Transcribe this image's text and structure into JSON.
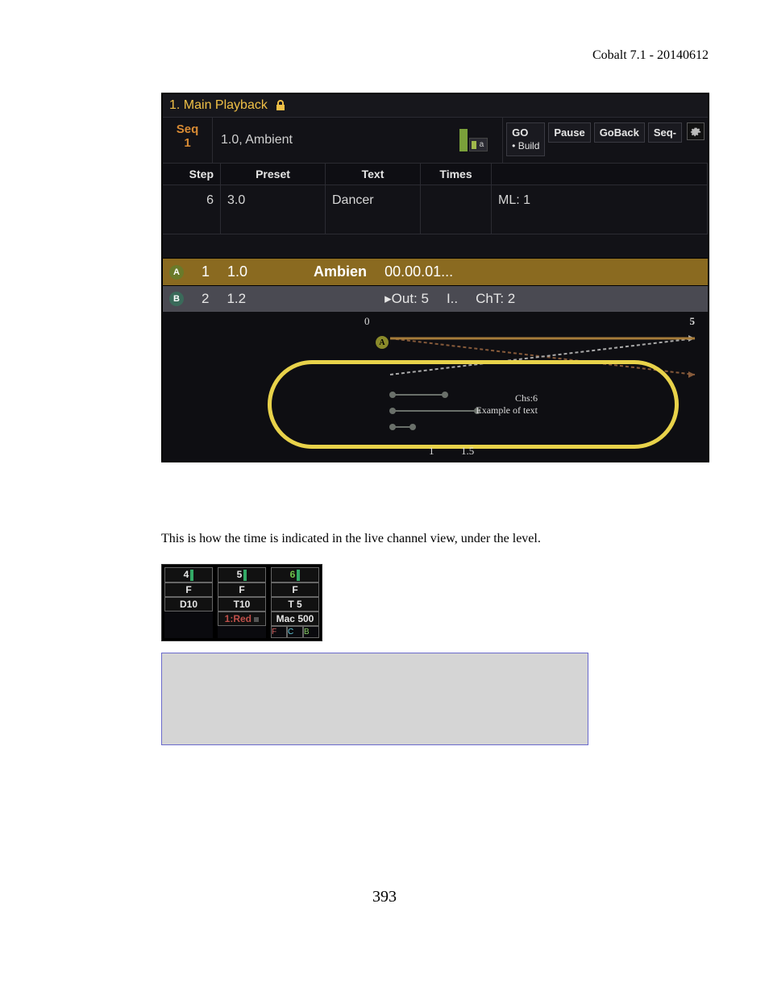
{
  "header": {
    "text": "Cobalt 7.1 - 20140612"
  },
  "panel": {
    "title": "1. Main Playback",
    "seq": {
      "label": "Seq",
      "num": "1",
      "info": "1.0, Ambient",
      "chip_label": "a"
    },
    "controls": {
      "go": "GO",
      "go_sub": "• Build",
      "pause": "Pause",
      "goback": "GoBack",
      "seqminus": "Seq-"
    },
    "columns": {
      "step": "Step",
      "preset": "Preset",
      "text": "Text",
      "times": "Times"
    },
    "row_dancer": {
      "step": "6",
      "preset": "3.0",
      "text": "Dancer",
      "ml": "ML: 1"
    },
    "row_a": {
      "badge": "A",
      "num": "1",
      "preset": "1.0",
      "text": "Ambien",
      "time": "00.00.01..."
    },
    "row_b": {
      "badge": "B",
      "num": "2",
      "preset": "1.2",
      "out": "▸Out: 5",
      "in": "I..",
      "cht": "ChT: 2"
    },
    "timeline": {
      "top0": "0",
      "top5": "5",
      "chs": "Chs:6",
      "example": "Example of text",
      "bot1": "1",
      "bot15": "1.5",
      "badge_a": "A"
    }
  },
  "caption": "This is how the time is indicated in the live channel view, under the level.",
  "channels": {
    "c1": {
      "n": "4",
      "v": "F",
      "d": "D10"
    },
    "c2": {
      "n": "5",
      "v": "F",
      "t": "T10",
      "r": "1:Red"
    },
    "c3": {
      "n": "6",
      "v": "F",
      "t": "T 5",
      "m": "Mac 500",
      "f": "F",
      "c": "C",
      "b": "B"
    }
  },
  "page": "393"
}
